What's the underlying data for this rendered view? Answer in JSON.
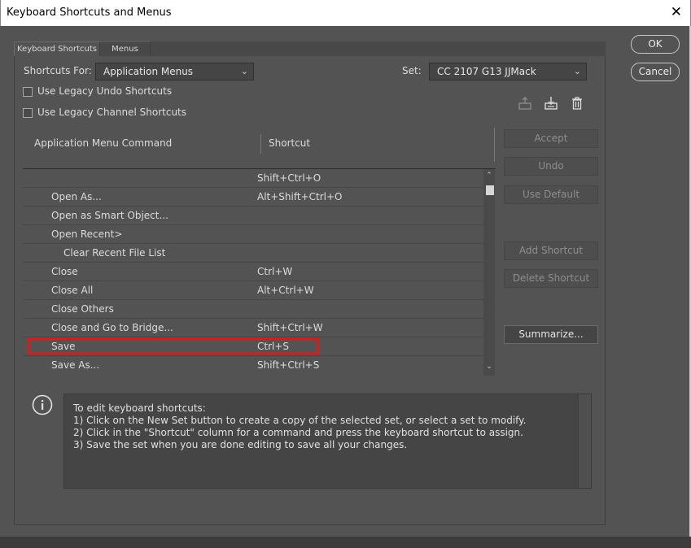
{
  "window": {
    "title": "Keyboard Shortcuts and Menus",
    "close_glyph": "✕"
  },
  "tabs": [
    {
      "label": "Keyboard Shortcuts",
      "active": true
    },
    {
      "label": "Menus",
      "active": false
    }
  ],
  "controls": {
    "shortcuts_for_label": "Shortcuts For:",
    "shortcuts_for_value": "Application Menus",
    "set_label": "Set:",
    "set_value": "CC 2107 G13 JJMack",
    "legacy_undo_label": "Use Legacy Undo Shortcuts",
    "legacy_undo_checked": false,
    "legacy_channel_label": "Use Legacy Channel Shortcuts",
    "legacy_channel_checked": false,
    "icons": [
      "save-set-icon",
      "new-set-icon",
      "delete-set-icon"
    ]
  },
  "table": {
    "columns": [
      "Application Menu Command",
      "Shortcut"
    ],
    "rows": [
      {
        "command": "",
        "shortcut": "Shift+Ctrl+O",
        "indent": 1
      },
      {
        "command": "Open As...",
        "shortcut": "Alt+Shift+Ctrl+O",
        "indent": 1
      },
      {
        "command": "Open as Smart Object...",
        "shortcut": "",
        "indent": 1
      },
      {
        "command": "Open Recent>",
        "shortcut": "",
        "indent": 1
      },
      {
        "command": "Clear Recent File List",
        "shortcut": "",
        "indent": 2
      },
      {
        "command": "Close",
        "shortcut": "Ctrl+W",
        "indent": 1
      },
      {
        "command": "Close All",
        "shortcut": "Alt+Ctrl+W",
        "indent": 1
      },
      {
        "command": "Close Others",
        "shortcut": "",
        "indent": 1
      },
      {
        "command": "Close and Go to Bridge...",
        "shortcut": "Shift+Ctrl+W",
        "indent": 1
      },
      {
        "command": "Save",
        "shortcut": "Ctrl+S",
        "indent": 1,
        "highlighted": true
      },
      {
        "command": "Save As...",
        "shortcut": "Shift+Ctrl+S",
        "indent": 1
      }
    ],
    "scroll_up": "⌃",
    "scroll_down": "⌄"
  },
  "side_buttons": {
    "accept": "Accept",
    "undo": "Undo",
    "use_default": "Use Default",
    "add_shortcut": "Add Shortcut",
    "delete_shortcut": "Delete Shortcut",
    "summarize": "Summarize..."
  },
  "dialog_buttons": {
    "ok": "OK",
    "cancel": "Cancel"
  },
  "info": {
    "lines": [
      "To edit keyboard shortcuts:",
      "1) Click on the New Set button to create a copy of the selected set, or select a set to modify.",
      "2) Click in the \"Shortcut\" column for a command and press the keyboard shortcut to assign.",
      "3) Save the set when you are done editing to save all your changes."
    ]
  },
  "colors": {
    "background": "#535353",
    "highlight_border": "#d91b1b"
  }
}
